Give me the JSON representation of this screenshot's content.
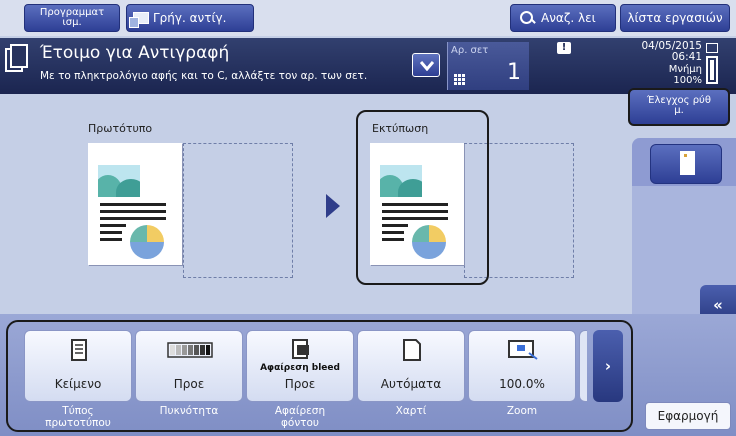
{
  "top_bar": {
    "program_label_line1": "Προγραμματ",
    "program_label_line2": "ισμ.",
    "quick_copy_label": "Γρήγ. αντίγ.",
    "search_label": "Αναζ. λει",
    "job_list_label": "λίστα εργασιών"
  },
  "status": {
    "title": "Έτοιμο για Αντιγραφή",
    "message": "Με το πληκτρολόγιο αφής και το C, αλλάξτε τον αρ. των σετ.",
    "copies_label": "Αρ. σετ",
    "copies_value": "1",
    "date": "04/05/2015",
    "time": "06:41",
    "memory_label": "Μνήμη",
    "memory_value": "100%"
  },
  "main": {
    "original_label": "Πρωτότυπο",
    "print_label": "Εκτύπωση"
  },
  "right_panel": {
    "check_label_line1": "Έλεγχος ρύθ",
    "check_label_line2": "μ.",
    "collapse_icon": "«"
  },
  "functions": [
    {
      "label": "Κείμενο",
      "caption_line1": "Τύπος",
      "caption_line2": "πρωτοτύπου",
      "icon": "text-doc-icon"
    },
    {
      "label": "Προε",
      "caption_line1": "Πυκνότητα",
      "caption_line2": "",
      "icon": "density-icon"
    },
    {
      "label": "Προε",
      "caption_line1": "Αφαίρεση",
      "caption_line2": "φόντου",
      "icon": "bleed-removal-icon",
      "overlay": "Αφαίρεση bleed"
    },
    {
      "label": "Αυτόματα",
      "caption_line1": "Χαρτί",
      "caption_line2": "",
      "icon": "paper-icon"
    },
    {
      "label": "100.0%",
      "caption_line1": "Zoom",
      "caption_line2": "",
      "icon": "zoom-icon"
    }
  ],
  "next_icon": "›",
  "apply_label": "Εφαρμογή",
  "colors": {
    "accent_dark": "#1b2550",
    "button_blue": "#2e3f95",
    "panel_bg": "#c5cfe6"
  }
}
